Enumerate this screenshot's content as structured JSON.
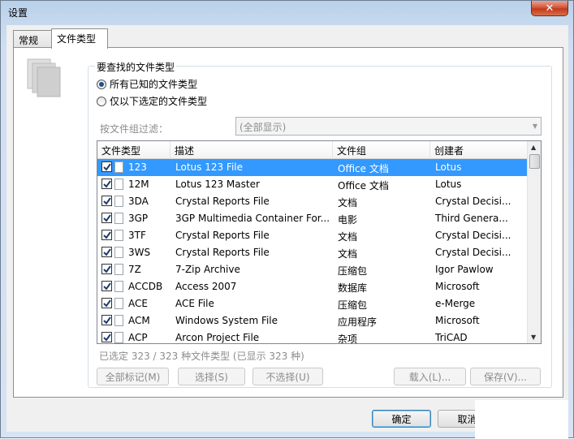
{
  "window": {
    "title": "设置",
    "close_label": "✕"
  },
  "tabs": [
    {
      "label": "常规",
      "active": false
    },
    {
      "label": "文件类型",
      "active": true
    }
  ],
  "group": {
    "title": "要查找的文件类型",
    "radio_all": "所有已知的文件类型",
    "radio_selected": "仅以下选定的文件类型",
    "radio_all_checked": true
  },
  "filter": {
    "label": "按文件组过滤：",
    "value": "(全部显示)"
  },
  "columns": [
    "文件类型",
    "描述",
    "文件组",
    "创建者"
  ],
  "rows": [
    {
      "type": "123",
      "desc": "Lotus 123 File",
      "group": "Office 文档",
      "creator": "Lotus",
      "selected": true
    },
    {
      "type": "12M",
      "desc": "Lotus 123 Master",
      "group": "Office 文档",
      "creator": "Lotus"
    },
    {
      "type": "3DA",
      "desc": "Crystal Reports File",
      "group": "文档",
      "creator": "Crystal Decisi..."
    },
    {
      "type": "3GP",
      "desc": "3GP Multimedia Container For...",
      "group": "电影",
      "creator": "Third Genera..."
    },
    {
      "type": "3TF",
      "desc": "Crystal Reports File",
      "group": "文档",
      "creator": "Crystal Decisi..."
    },
    {
      "type": "3WS",
      "desc": "Crystal Reports File",
      "group": "文档",
      "creator": "Crystal Decisi..."
    },
    {
      "type": "7Z",
      "desc": "7-Zip Archive",
      "group": "压缩包",
      "creator": "Igor Pawlow"
    },
    {
      "type": "ACCDB",
      "desc": "Access 2007",
      "group": "数据库",
      "creator": "Microsoft"
    },
    {
      "type": "ACE",
      "desc": "ACE File",
      "group": "压缩包",
      "creator": "e-Merge"
    },
    {
      "type": "ACM",
      "desc": "Windows System File",
      "group": "应用程序",
      "creator": "Microsoft"
    },
    {
      "type": "ACP",
      "desc": "Arcon Project File",
      "group": "杂项",
      "creator": "TriCAD"
    }
  ],
  "status": "已选定 323 / 323 种文件类型 (已显示 323 种)",
  "buttons": {
    "mark_all": "全部标记(M)",
    "select": "选择(S)",
    "deselect": "不选择(U)",
    "load": "载入(L)...",
    "save": "保存(V)...",
    "ok": "确定",
    "cancel": "取消"
  },
  "colors": {
    "selection": "#3399ff",
    "window_frame": "#c7d9ee"
  }
}
